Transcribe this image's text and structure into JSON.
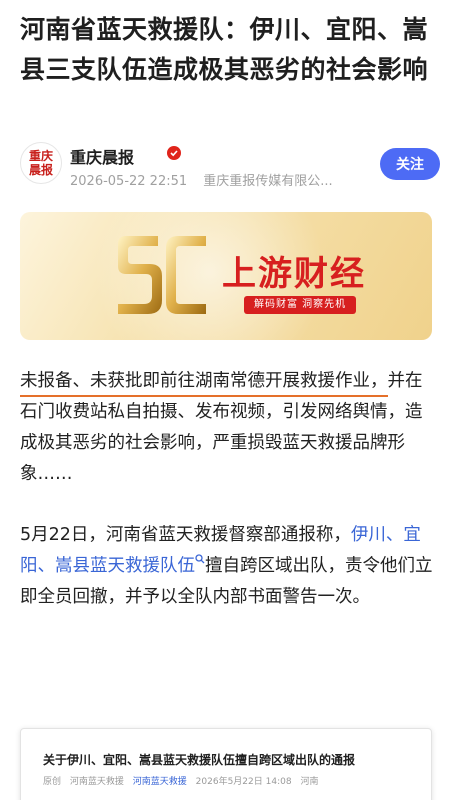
{
  "article": {
    "title": "河南省蓝天救援队：伊川、宜阳、嵩县三支队伍造成极其恶劣的社会影响"
  },
  "author": {
    "avatar_text_1": "重庆",
    "avatar_text_2": "晨报",
    "name": "重庆晨报",
    "datetime": "2026-05-22 22:51",
    "publisher": "重庆重报传媒有限公...",
    "follow_label": "关注"
  },
  "banner": {
    "brand": "上游财经",
    "slogan": "解码财富  洞察先机",
    "logo_icon": "sc-logo-icon",
    "colors": {
      "brand_red": "#d71f1f",
      "gold": "#f0d28c"
    }
  },
  "paragraph1": {
    "highlight": "未报备、未获批即前往湖南常德开展救援作业，",
    "rest": "并在石门收费站私自拍摄、发布视频，引发网络舆情，造成极其恶劣的社会影响，严重损毁蓝天救援品牌形象……"
  },
  "paragraph2": {
    "lead": "5月22日，河南省蓝天救援督察部通报称，",
    "link": "伊川、宜阳、嵩县蓝天救援队伍",
    "rest": "擅自跨区域出队，责令他们立即全员回撤，并予以全队内部书面警告一次。"
  },
  "doc_card": {
    "title": "关于伊川、宜阳、嵩县蓝天救援队伍擅自跨区域出队的通报",
    "tag": "原创",
    "org": "河南蓝天救援",
    "account": "河南蓝天救援",
    "date": "2026年5月22日 14:08",
    "location": "河南"
  },
  "colors": {
    "follow_button": "#4d6bf5",
    "link": "#3a66d6",
    "underline": "#e5702a",
    "verified": "#e0241b"
  }
}
